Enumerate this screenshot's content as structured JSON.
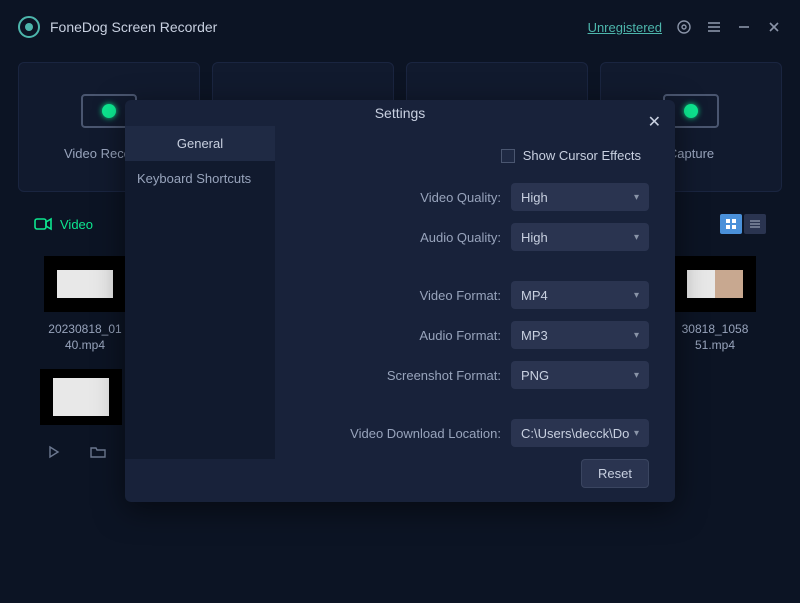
{
  "header": {
    "title": "FoneDog Screen Recorder",
    "unregistered": "Unregistered"
  },
  "modes": [
    {
      "label": "Video Recorder"
    },
    {
      "label": ""
    },
    {
      "label": ""
    },
    {
      "label": "Capture",
      "suffix": true
    }
  ],
  "library": {
    "tabs": {
      "video": "Video"
    },
    "items": [
      {
        "name": "20230818_01\n40.mp4"
      },
      {
        "name": "30818_1058\n51.mp4"
      }
    ]
  },
  "settings": {
    "title": "Settings",
    "tabs": {
      "general": "General",
      "shortcuts": "Keyboard Shortcuts"
    },
    "showCursor": "Show Cursor Effects",
    "fields": {
      "videoQuality": {
        "label": "Video Quality:",
        "value": "High"
      },
      "audioQuality": {
        "label": "Audio Quality:",
        "value": "High"
      },
      "videoFormat": {
        "label": "Video Format:",
        "value": "MP4"
      },
      "audioFormat": {
        "label": "Audio Format:",
        "value": "MP3"
      },
      "screenshotFormat": {
        "label": "Screenshot Format:",
        "value": "PNG"
      },
      "downloadLoc": {
        "label": "Video Download Location:",
        "value": "C:\\Users\\decck\\Do"
      }
    },
    "reset": "Reset"
  }
}
